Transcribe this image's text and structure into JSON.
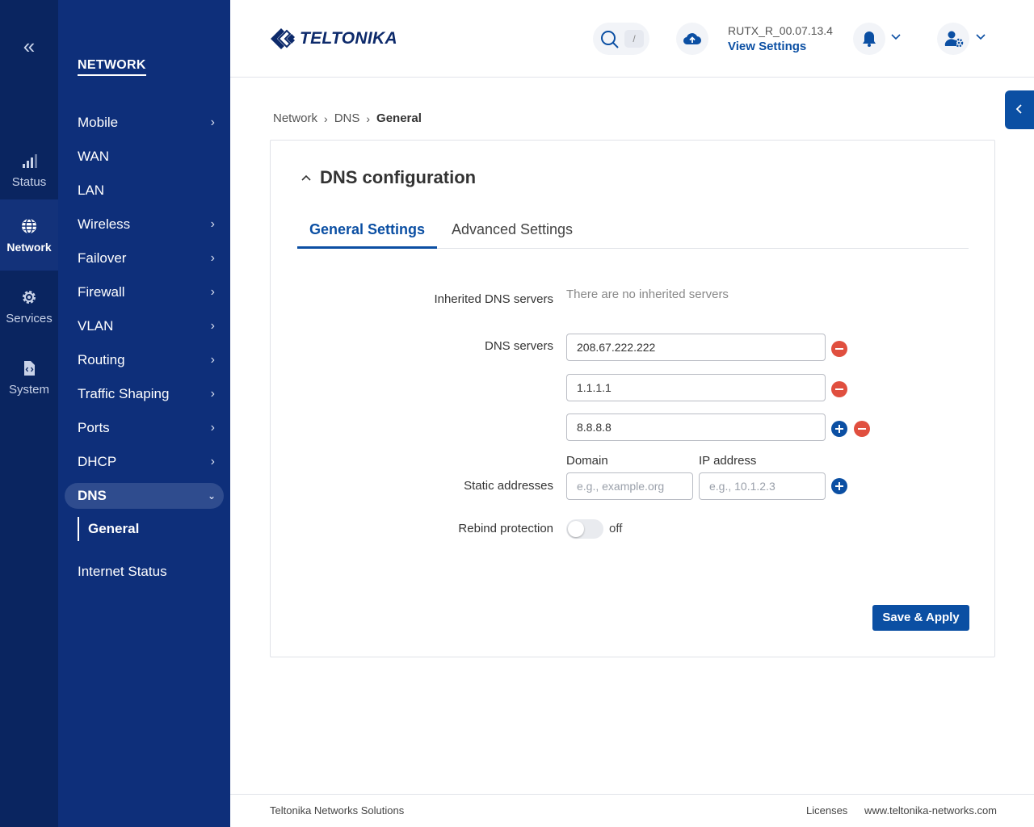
{
  "rail": {
    "items": [
      {
        "label": "Status",
        "icon": "signal-bars-icon"
      },
      {
        "label": "Network",
        "icon": "globe-icon",
        "active": true
      },
      {
        "label": "Services",
        "icon": "gear-icon"
      },
      {
        "label": "System",
        "icon": "system-file-icon"
      }
    ]
  },
  "subnav": {
    "title": "NETWORK",
    "items": [
      {
        "label": "Mobile",
        "chevron": true
      },
      {
        "label": "WAN",
        "chevron": false
      },
      {
        "label": "LAN",
        "chevron": false
      },
      {
        "label": "Wireless",
        "chevron": true
      },
      {
        "label": "Failover",
        "chevron": true
      },
      {
        "label": "Firewall",
        "chevron": true
      },
      {
        "label": "VLAN",
        "chevron": true
      },
      {
        "label": "Routing",
        "chevron": true
      },
      {
        "label": "Traffic Shaping",
        "chevron": true
      },
      {
        "label": "Ports",
        "chevron": true
      },
      {
        "label": "DHCP",
        "chevron": true
      },
      {
        "label": "DNS",
        "chevron": true,
        "open": true
      },
      {
        "label": "Internet Status",
        "chevron": false
      }
    ],
    "active_sub": "General"
  },
  "header": {
    "logo_text": "TELTONIKA",
    "search_shortcut": "/",
    "firmware": "RUTX_R_00.07.13.4",
    "view_settings": "View Settings"
  },
  "breadcrumb": [
    "Network",
    "DNS",
    "General"
  ],
  "section": {
    "title": "DNS configuration",
    "tabs": [
      "General Settings",
      "Advanced Settings"
    ],
    "active_tab": 0
  },
  "form": {
    "inherited_label": "Inherited DNS servers",
    "inherited_value": "There are no inherited servers",
    "dns_label": "DNS servers",
    "dns_servers": [
      "208.67.222.222",
      "1.1.1.1",
      "8.8.8.8"
    ],
    "static_label": "Static addresses",
    "domain_head": "Domain",
    "ip_head": "IP address",
    "domain_placeholder": "e.g., example.org",
    "ip_placeholder": "e.g., 10.1.2.3",
    "rebind_label": "Rebind protection",
    "rebind_state": "off",
    "rebind_on": false
  },
  "actions": {
    "save_apply": "Save & Apply"
  },
  "footer": {
    "company": "Teltonika Networks Solutions",
    "licenses": "Licenses",
    "website": "www.teltonika-networks.com"
  },
  "colors": {
    "rail_bg": "#0a2560",
    "subnav_bg": "#0e2f7a",
    "accent": "#0b4fa3",
    "remove": "#e04f3f"
  }
}
